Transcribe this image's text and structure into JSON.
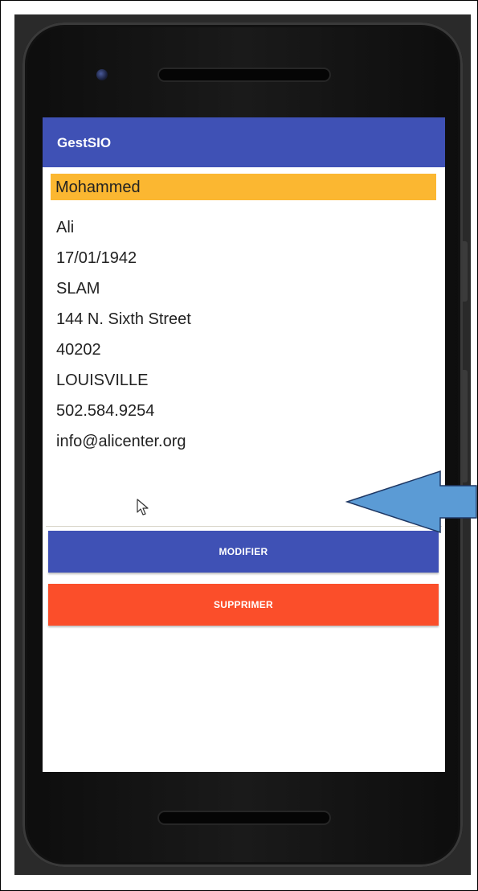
{
  "app": {
    "title": "GestSIO"
  },
  "person": {
    "nom": "Mohammed",
    "prenom": "Ali",
    "date_naissance": "17/01/1942",
    "option": "SLAM",
    "adresse": "144 N. Sixth Street",
    "code_postal": "40202",
    "ville": "LOUISVILLE",
    "telephone": "502.584.9254",
    "email": "info@alicenter.org"
  },
  "actions": {
    "modifier_label": "MODIFIER",
    "supprimer_label": "SUPPRIMER"
  },
  "colors": {
    "app_bar": "#3f51b5",
    "highlight": "#fbb731",
    "modifier": "#3f51b5",
    "supprimer": "#fb4e2a",
    "annotation_arrow": "#5b9bd5"
  },
  "icons": {
    "cursor": "mouse-pointer-icon",
    "annotation": "left-arrow-icon"
  }
}
